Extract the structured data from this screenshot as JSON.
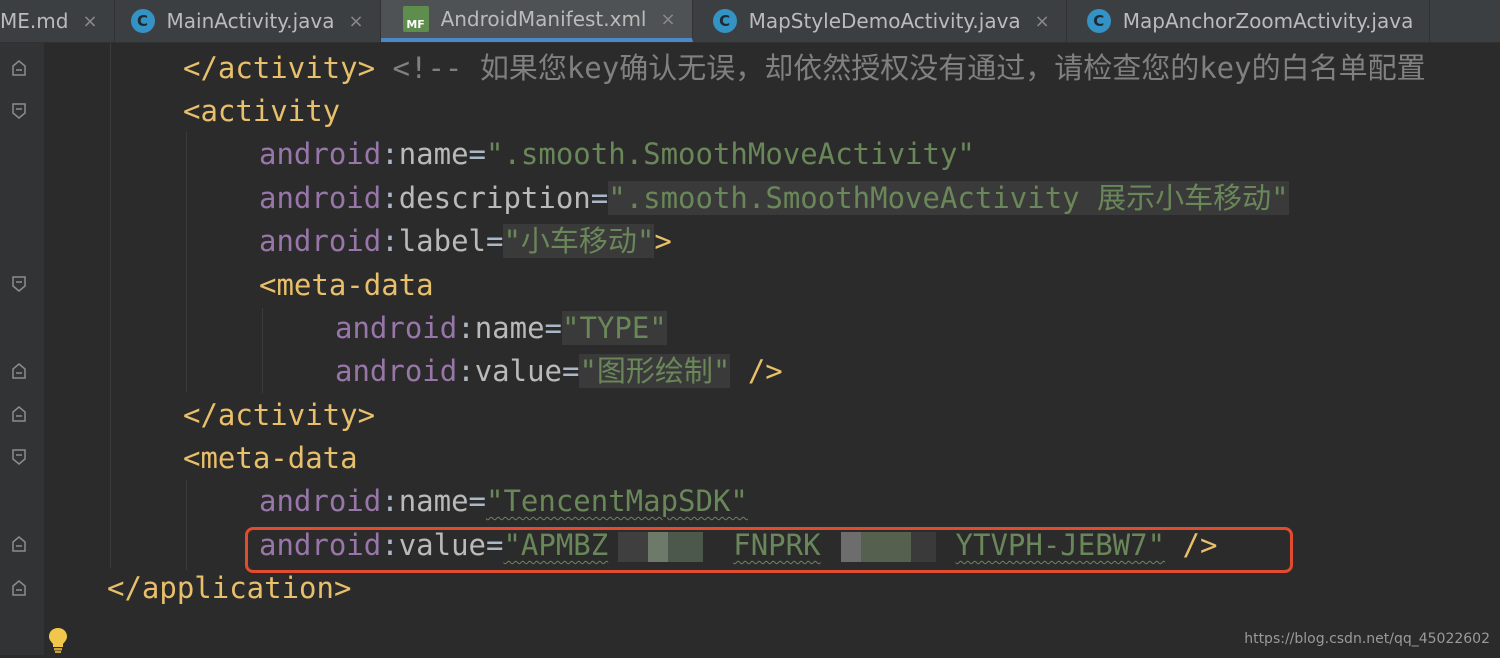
{
  "tabs": [
    {
      "label": "ME.md",
      "icon": "markdown-file-icon",
      "active": false
    },
    {
      "label": "MainActivity.java",
      "icon": "java-class-icon",
      "active": false
    },
    {
      "label": "AndroidManifest.xml",
      "icon": "manifest-file-icon",
      "active": true
    },
    {
      "label": "MapStyleDemoActivity.java",
      "icon": "java-class-icon",
      "active": false
    },
    {
      "label": "MapAnchorZoomActivity.java",
      "icon": "java-class-icon",
      "active": false
    }
  ],
  "tab_icon_letter": "C",
  "manifest_icon_letters": "MF",
  "close_glyph": "×",
  "code": {
    "l1": {
      "tag": "</activity>",
      "comment": "<!-- 如果您key确认无误，却依然授权没有通过，请检查您的key的白名单配置"
    },
    "l2": {
      "tag": "<activity"
    },
    "l3": {
      "ns": "android",
      "colon": ":",
      "attr": "name",
      "eq": "=",
      "value": "\".smooth.SmoothMoveActivity\""
    },
    "l4": {
      "ns": "android",
      "colon": ":",
      "attr": "description",
      "eq": "=",
      "value": "\".smooth.SmoothMoveActivity 展示小车移动\""
    },
    "l5": {
      "ns": "android",
      "colon": ":",
      "attr": "label",
      "eq": "=",
      "value": "\"小车移动\"",
      "close": ">"
    },
    "l6": {
      "tag": "<meta-data"
    },
    "l7": {
      "ns": "android",
      "colon": ":",
      "attr": "name",
      "eq": "=",
      "value": "\"TYPE\""
    },
    "l8": {
      "ns": "android",
      "colon": ":",
      "attr": "value",
      "eq": "=",
      "value": "\"图形绘制\"",
      "close": " />"
    },
    "l9": {
      "tag": "</activity>"
    },
    "l10": {
      "tag": "<meta-data"
    },
    "l11": {
      "ns": "android",
      "colon": ":",
      "attr": "name",
      "eq": "=",
      "value": "\"TencentMapSDK\""
    },
    "l12": {
      "ns": "android",
      "colon": ":",
      "attr": "value",
      "eq": "=",
      "value_a": "\"APMBZ",
      "value_b": "FNPRK",
      "value_c": "YTVPH-JEBW7\"",
      "close": " />"
    },
    "l13": {
      "tag": "</application>"
    }
  },
  "watermark": "https://blog.csdn.net/qq_45022602",
  "colors": {
    "background": "#2b2b2b",
    "tag": "#e8bf6a",
    "namespace": "#9876aa",
    "string": "#6a8759",
    "highlight_box": "#e24b2d"
  }
}
